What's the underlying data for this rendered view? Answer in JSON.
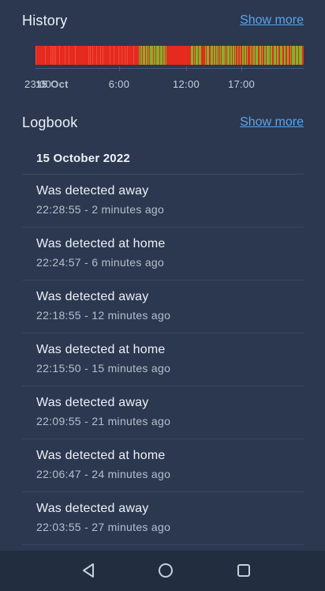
{
  "history": {
    "title": "History",
    "show_more": "Show more",
    "axis_labels": [
      "23:00",
      "15 Oct",
      "6:00",
      "12:00",
      "17:00"
    ],
    "colors": {
      "away": "#e52a1f",
      "home": "#7fb32b"
    }
  },
  "logbook": {
    "title": "Logbook",
    "show_more": "Show more",
    "date_heading": "15 October 2022",
    "entries": [
      {
        "message": "Was detected away",
        "meta": "22:28:55 - 2 minutes ago"
      },
      {
        "message": "Was detected at home",
        "meta": "22:24:57 - 6 minutes ago"
      },
      {
        "message": "Was detected away",
        "meta": "22:18:55 - 12 minutes ago"
      },
      {
        "message": "Was detected at home",
        "meta": "22:15:50 - 15 minutes ago"
      },
      {
        "message": "Was detected away",
        "meta": "22:09:55 - 21 minutes ago"
      },
      {
        "message": "Was detected at home",
        "meta": "22:06:47 - 24 minutes ago"
      },
      {
        "message": "Was detected away",
        "meta": "22:03:55 - 27 minutes ago"
      }
    ]
  },
  "navigation": {
    "back_icon": "back-triangle-icon",
    "home_icon": "home-circle-icon",
    "recents_icon": "recents-square-icon"
  }
}
